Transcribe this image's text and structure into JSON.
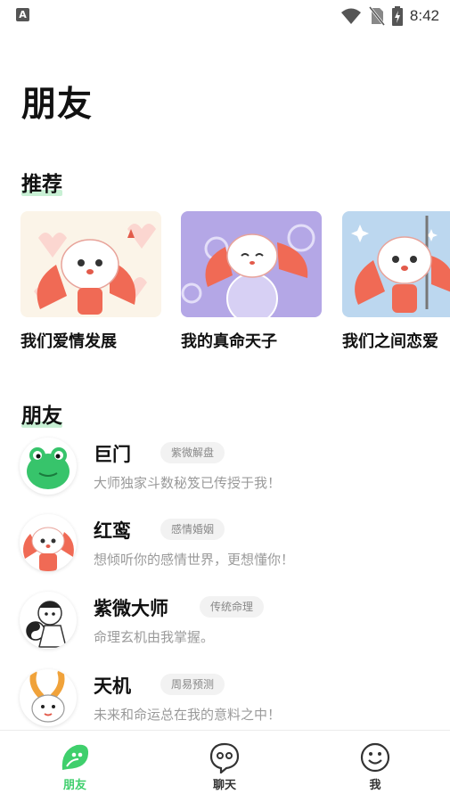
{
  "status_bar": {
    "time": "8:42",
    "app_icon_letter": "A"
  },
  "page_title": "朋友",
  "sections": {
    "recommend": "推荐",
    "friends": "朋友"
  },
  "recommend_cards": [
    {
      "label": "我们爱情发展"
    },
    {
      "label": "我的真命天子"
    },
    {
      "label": "我们之间恋爱"
    }
  ],
  "friends": [
    {
      "name": "巨门",
      "tag": "紫微解盘",
      "desc": "大师独家斗数秘笈已传授于我！",
      "avatar_icon": "frog-avatar-icon"
    },
    {
      "name": "红鸾",
      "tag": "感情婚姻",
      "desc": "想倾听你的感情世界，更想懂你！",
      "avatar_icon": "rabbit-avatar-icon"
    },
    {
      "name": "紫微大师",
      "tag": "传统命理",
      "desc": "命理玄机由我掌握。",
      "avatar_icon": "master-avatar-icon"
    },
    {
      "name": "天机",
      "tag": "周易预测",
      "desc": "未来和命运总在我的意料之中！",
      "avatar_icon": "bunny-avatar-icon"
    }
  ],
  "bottom_nav": [
    {
      "label": "朋友",
      "active": true,
      "icon": "leaf-chat-icon"
    },
    {
      "label": "聊天",
      "active": false,
      "icon": "chat-bubble-icon"
    },
    {
      "label": "我",
      "active": false,
      "icon": "smiley-icon"
    }
  ],
  "colors": {
    "accent": "#3fcf6c",
    "highlight": "#c8f0d4"
  }
}
